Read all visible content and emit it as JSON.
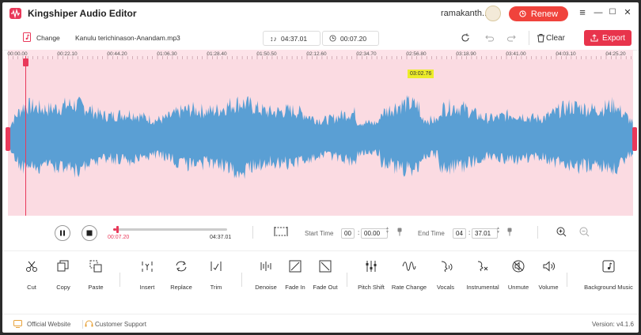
{
  "app": {
    "title": "Kingshiper Audio Editor",
    "username": "ramakanth..."
  },
  "titlebar": {
    "renew_label": "Renew",
    "min": "—",
    "max": "☐",
    "close": "✕"
  },
  "toolbar": {
    "change_label": "Change",
    "file_name": "Kanulu terichinason-Anandam.mp3",
    "total_duration": "04:37.01",
    "current_time": "00:07.20",
    "clear_label": "Clear",
    "export_label": "Export"
  },
  "ruler": {
    "ticks": [
      "00:00.00",
      "00:22.10",
      "00:44.20",
      "01:06.30",
      "01:28.40",
      "01:50.50",
      "02:12.60",
      "02:34.70",
      "02:56.80",
      "03:18.90",
      "03:41.00",
      "04:03.10",
      "04:25.20"
    ]
  },
  "waveform": {
    "hover_time": "03:02.76",
    "progress": 0.026,
    "colors": {
      "wave": "#5a9fd4",
      "background": "#fbdbe2",
      "accent": "#e9395a"
    }
  },
  "player": {
    "elapsed": "00:07.20",
    "duration": "04:37.01",
    "start_time_label": "Start Time",
    "start_min": "00",
    "start_sec": "00.00",
    "end_time_label": "End Time",
    "end_min": "04",
    "end_sec": "37.01",
    "colon": ":"
  },
  "tools": [
    {
      "label": "Cut",
      "icon": "scissors-icon"
    },
    {
      "label": "Copy",
      "icon": "copy-icon"
    },
    {
      "label": "Paste",
      "icon": "paste-icon"
    },
    {
      "label": "Insert",
      "icon": "insert-icon"
    },
    {
      "label": "Replace",
      "icon": "replace-icon"
    },
    {
      "label": "Trim",
      "icon": "trim-icon"
    },
    {
      "label": "Denoise",
      "icon": "denoise-icon"
    },
    {
      "label": "Fade In",
      "icon": "fade-in-icon"
    },
    {
      "label": "Fade Out",
      "icon": "fade-out-icon"
    },
    {
      "label": "Pitch Shift",
      "icon": "pitch-shift-icon"
    },
    {
      "label": "Rate Change",
      "icon": "rate-change-icon"
    },
    {
      "label": "Vocals",
      "icon": "vocals-icon"
    },
    {
      "label": "Instrumental",
      "icon": "instrumental-icon"
    },
    {
      "label": "Unmute",
      "icon": "unmute-icon"
    },
    {
      "label": "Volume",
      "icon": "volume-icon"
    },
    {
      "label": "Background Music",
      "icon": "background-music-icon"
    }
  ],
  "footer": {
    "official_website": "Official Website",
    "customer_support": "Customer Support",
    "version": "Version: v4.1.6"
  }
}
